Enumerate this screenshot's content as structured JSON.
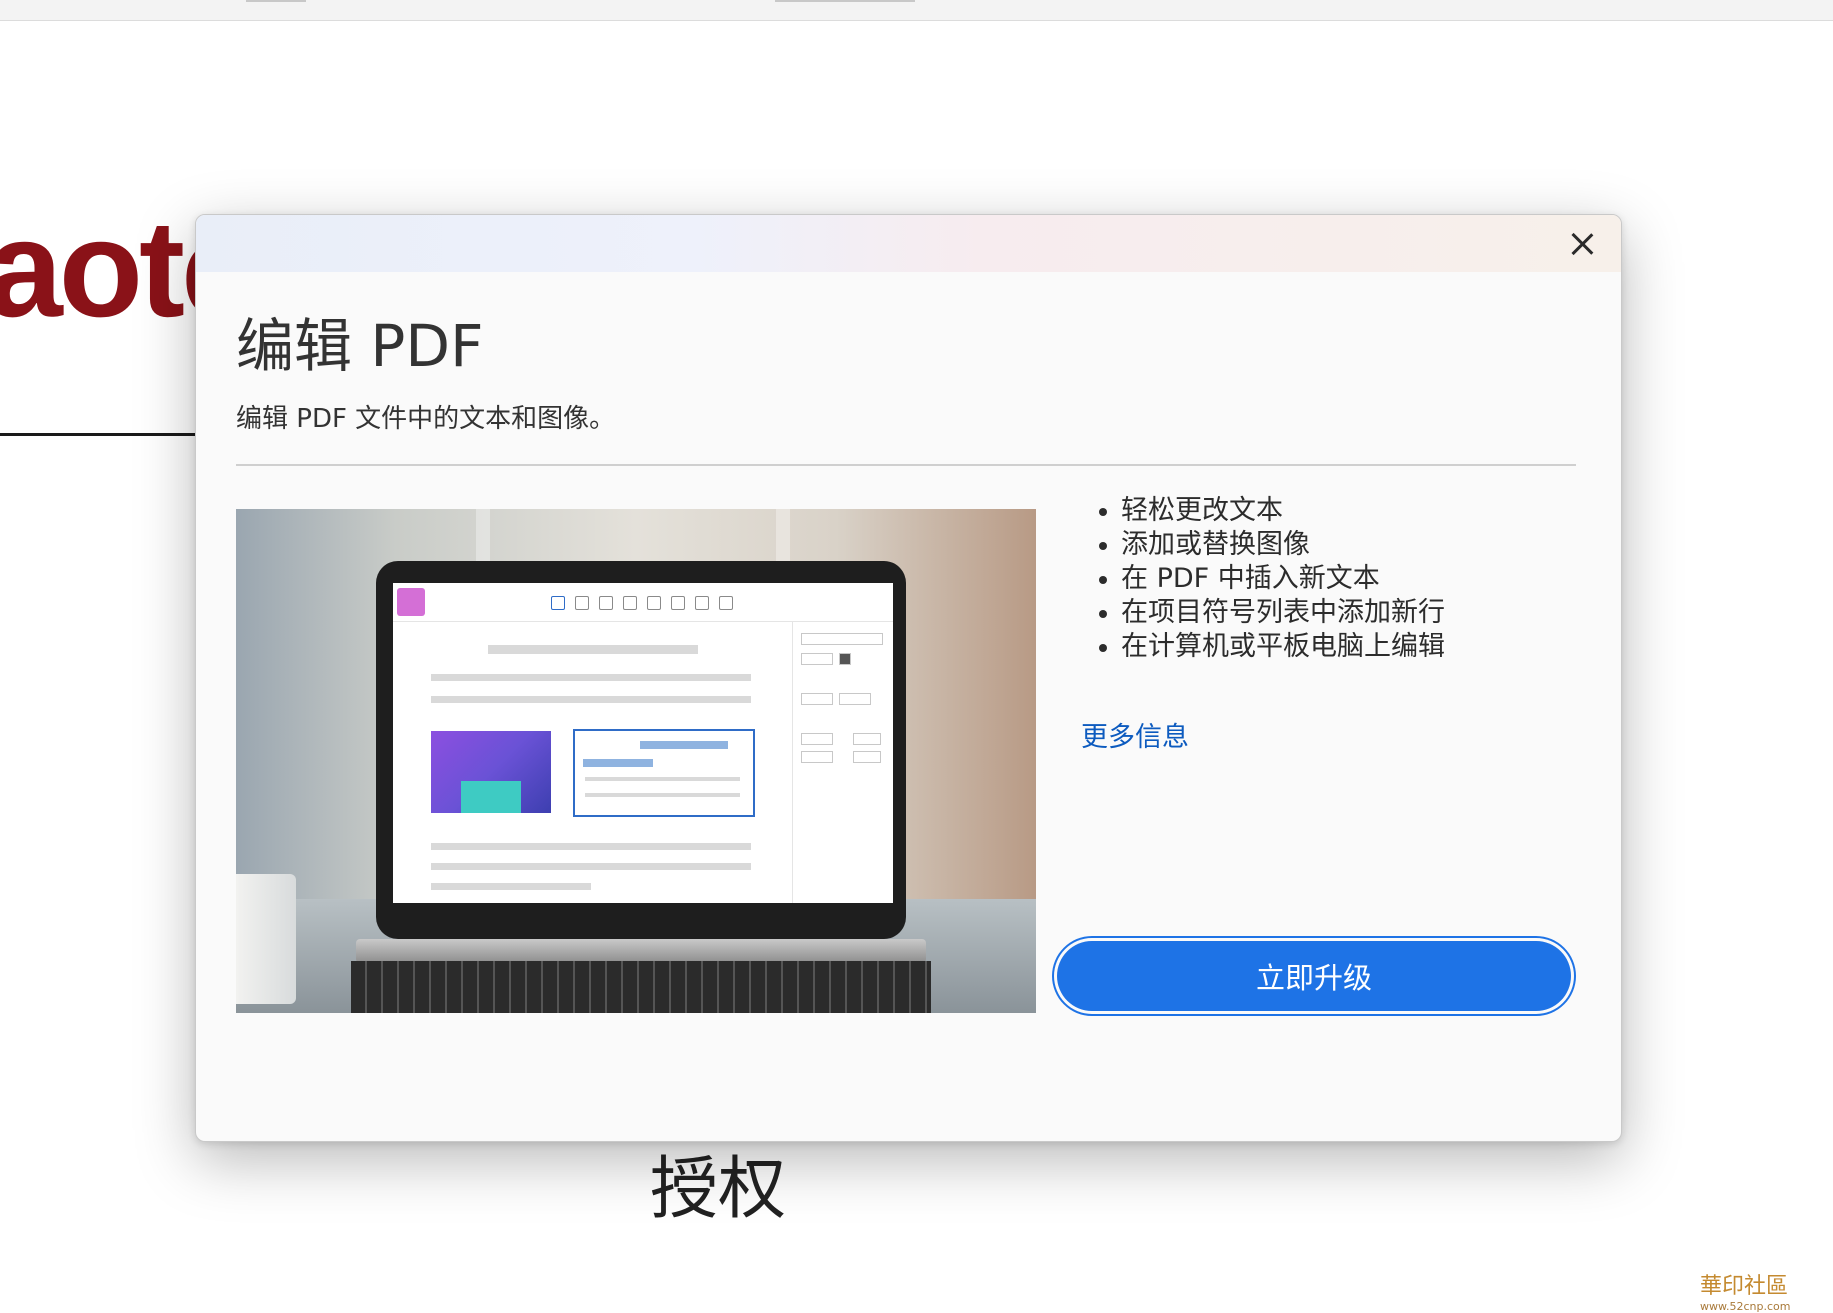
{
  "background": {
    "brand_text": "aote",
    "caption": "授权"
  },
  "dialog": {
    "close_label": "×",
    "title": "编辑 PDF",
    "subtitle": "编辑 PDF 文件中的文本和图像。",
    "features": [
      "轻松更改文本",
      "添加或替换图像",
      "在 PDF 中插入新文本",
      "在项目符号列表中添加新行",
      "在计算机或平板电脑上编辑"
    ],
    "more_info_label": "更多信息",
    "upgrade_label": "立即升级",
    "hero_icon": "laptop-edit-pdf-illustration"
  },
  "watermark": {
    "text": "華印社區",
    "url": "www.52cnp.com"
  },
  "colors": {
    "accent": "#1e73e6",
    "link": "#0d5bbf",
    "brand": "#8a1218"
  }
}
